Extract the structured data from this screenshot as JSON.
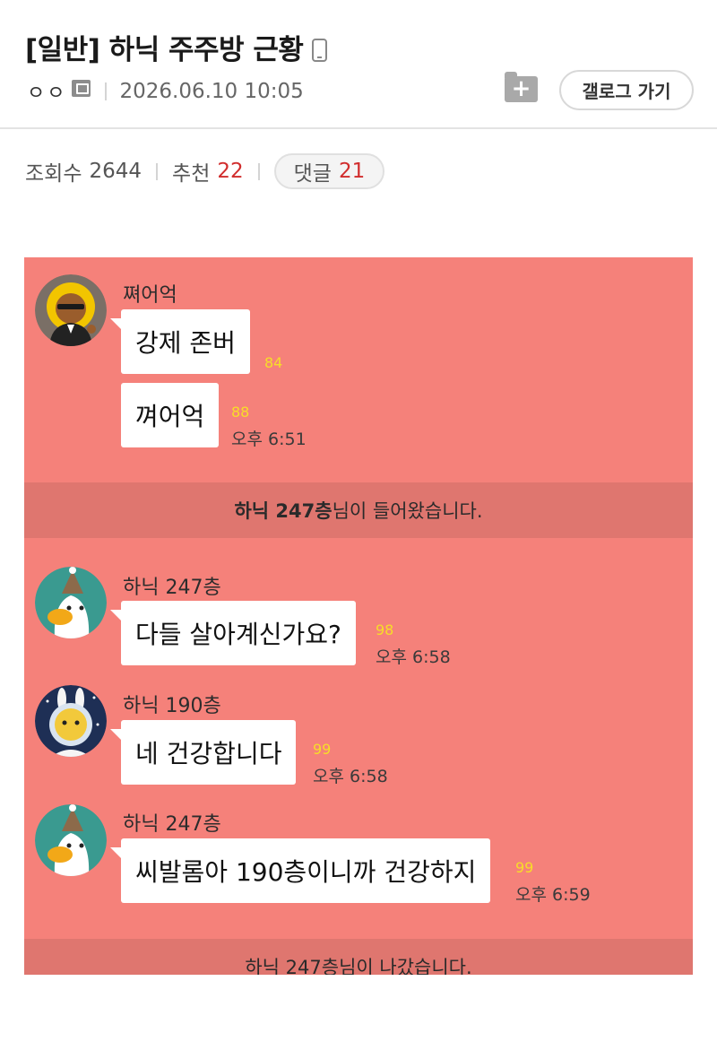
{
  "post": {
    "title": "[일반] 하닉 주주방 근황",
    "author": "ㅇㅇ",
    "date": "2026.06.10 10:05",
    "gallog_label": "갤로그 가기"
  },
  "stats": {
    "views_label": "조회수",
    "views": "2644",
    "recommend_label": "추천",
    "recommend": "22",
    "comments_label": "댓글",
    "comments": "21"
  },
  "chat": {
    "bg_color": "#f5817a",
    "system_bg_color": "#df766f",
    "blocks": [
      {
        "sender": "쪄어억",
        "bubbles": [
          {
            "text": "강제 존버",
            "unread": "84",
            "time": ""
          },
          {
            "text": "껴어억",
            "unread": "88",
            "time": "오후 6:51"
          }
        ]
      },
      {
        "system": {
          "name": "하닉 247층",
          "suffix": "님이 들어왔습니다."
        }
      },
      {
        "sender": "하닉 247층",
        "bubbles": [
          {
            "text": "다들 살아계신가요?",
            "unread": "98",
            "time": "오후 6:58"
          }
        ]
      },
      {
        "sender": "하닉 190층",
        "bubbles": [
          {
            "text": "네 건강합니다",
            "unread": "99",
            "time": "오후 6:58"
          }
        ]
      },
      {
        "sender": "하닉 247층",
        "bubbles": [
          {
            "text": "씨발롬아 190층이니까 건강하지",
            "unread": "99",
            "time": "오후 6:59"
          }
        ]
      },
      {
        "system": {
          "name": "하닉 247층",
          "suffix": "님이 나갔습니다."
        }
      }
    ]
  }
}
